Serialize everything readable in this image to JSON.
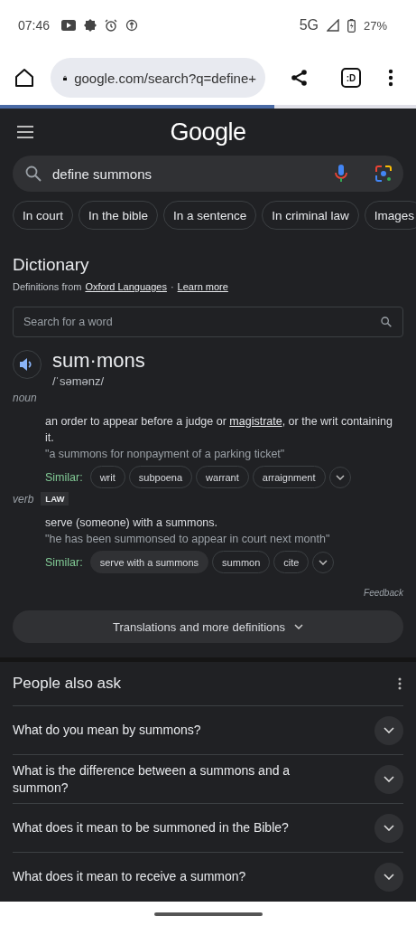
{
  "status_bar": {
    "time": "07:46",
    "network": "5G",
    "battery": "27%"
  },
  "browser": {
    "url": "google.com/search?q=define+",
    "tab_button": ":D",
    "load_progress": {
      "level": 0.66
    }
  },
  "search": {
    "logo": "Google",
    "query": "define summons"
  },
  "chips": [
    "In court",
    "In the bible",
    "In a sentence",
    "In criminal law",
    "Images"
  ],
  "dictionary": {
    "title": "Dictionary",
    "source_prefix": "Definitions from",
    "source_link": "Oxford Languages",
    "separator": "·",
    "learn_more": "Learn more",
    "search_placeholder": "Search for a word",
    "word": "sum·mons",
    "phonetic": "/ˈsəmənz/",
    "senses": [
      {
        "pos": "noun",
        "definition": [
          {
            "text": "an order to appear before a judge or ",
            "link": false
          },
          {
            "text": "magistrate",
            "link": true
          },
          {
            "text": ", or the writ containing it.",
            "link": false
          }
        ],
        "example": "\"a summons for nonpayment of a parking ticket\"",
        "similar_label": "Similar:",
        "similar": [
          {
            "text": "writ",
            "highlighted": false
          },
          {
            "text": "subpoena",
            "highlighted": false
          },
          {
            "text": "warrant",
            "highlighted": false
          },
          {
            "text": "arraignment",
            "highlighted": false
          }
        ]
      },
      {
        "pos": "verb",
        "tag": "LAW",
        "definition": [
          {
            "text": "serve (someone) with a summons.",
            "link": false
          }
        ],
        "example": "\"he has been summonsed to appear in court next month\"",
        "similar_label": "Similar:",
        "similar": [
          {
            "text": "serve with a summons",
            "highlighted": true
          },
          {
            "text": "summon",
            "highlighted": false
          },
          {
            "text": "cite",
            "highlighted": false
          }
        ]
      }
    ],
    "feedback": "Feedback",
    "more_button": "Translations and more definitions"
  },
  "people_also_ask": {
    "title": "People also ask",
    "questions": [
      {
        "text": "What do you mean by summons?",
        "expanded": false
      },
      {
        "text": "What is the difference between a summons and a summon?",
        "expanded": false
      },
      {
        "text": "What does it mean to be summoned in the Bible?",
        "expanded": false
      },
      {
        "text": "What does it mean to receive a summon?",
        "expanded": false
      }
    ]
  }
}
